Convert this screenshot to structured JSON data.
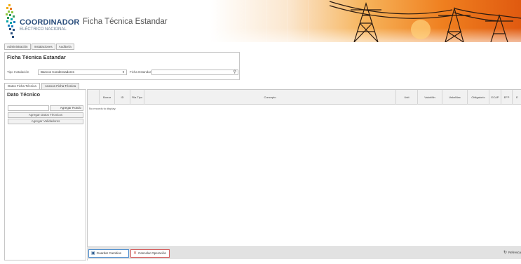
{
  "header": {
    "logo_line1": "COORDINADOR",
    "logo_line2": "ELÉCTRICO NACIONAL",
    "app_title": "Ficha Técnica Estandar",
    "logo_icon": "coordinador-pixel-logo",
    "banner_icon": "power-towers-sunset-banner"
  },
  "menu": {
    "items": [
      {
        "label": "Administración"
      },
      {
        "label": "Instalaciones"
      },
      {
        "label": "Auditoría"
      }
    ]
  },
  "filter": {
    "title": "Ficha Técnica Estandar",
    "tipo_label": "Tipo Instalación",
    "tipo_value": "Bancos Condensadores",
    "ficha_label": "Ficha Estandar",
    "ficha_value": "",
    "search_icon": "search-icon"
  },
  "tabs": [
    {
      "label": "Datos Ficha Técnica",
      "active": true
    },
    {
      "label": "Anexos Ficha Técnica",
      "active": false
    }
  ],
  "left_panel": {
    "title": "Dato Técnico",
    "rotulo_value": "",
    "agregar_rotulo": "Agregar Rotulo",
    "agregar_datos": "Agregar Datos Técnicos",
    "agregar_validadores": "Agregar Validadores"
  },
  "grid": {
    "columns": [
      {
        "label": ""
      },
      {
        "label": "Borrar"
      },
      {
        "label": "ID"
      },
      {
        "label": "Fila Tipo"
      },
      {
        "label": "Concepto"
      },
      {
        "label": "Unit"
      },
      {
        "label": "ValorMin"
      },
      {
        "label": "ValorMax"
      },
      {
        "label": "Obligatorio"
      },
      {
        "label": "ECAP"
      },
      {
        "label": "EFP"
      },
      {
        "label": "E"
      }
    ],
    "no_records": "No records to display."
  },
  "toolbar": {
    "save_label": "Guardar Cambios",
    "cancel_label": "Cancelar Operación",
    "refresh_label": "Refresca",
    "save_icon": "save-icon",
    "cancel_icon": "close-icon",
    "refresh_icon": "refresh-icon"
  },
  "colors": {
    "logo_blue": "#2a4e7c",
    "banner_orange": "#f08a22",
    "save_border": "#4f8fcf",
    "cancel_border": "#d55b5b"
  }
}
